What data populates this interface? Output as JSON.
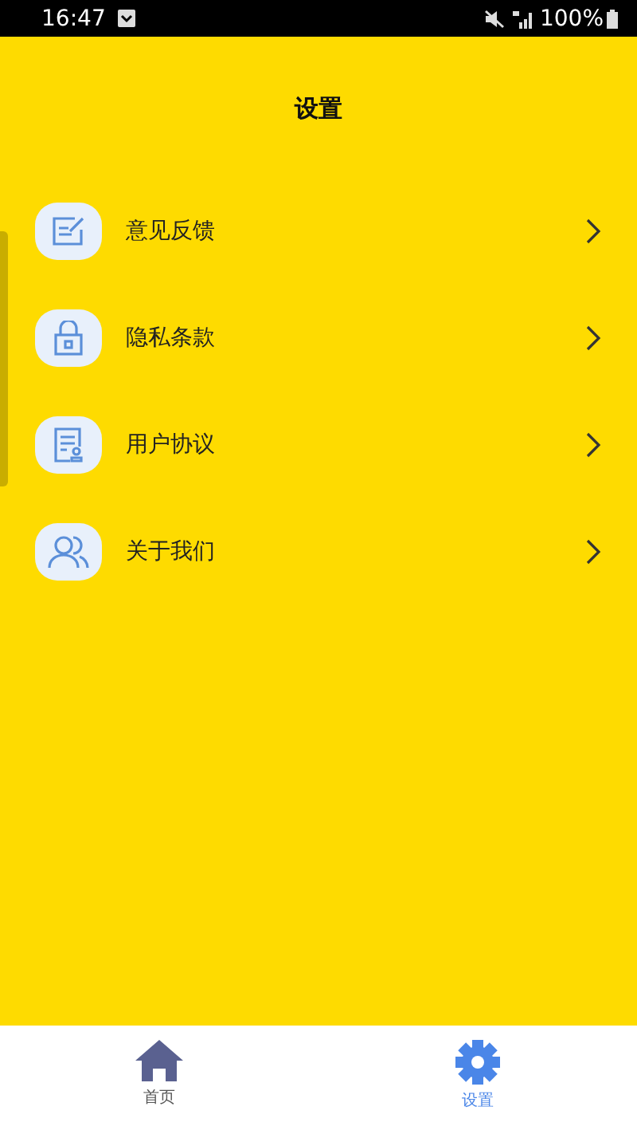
{
  "status_bar": {
    "time": "16:47",
    "battery": "100%"
  },
  "title": "设置",
  "items": [
    {
      "label": "意见反馈",
      "kind": "feedback"
    },
    {
      "label": "隐私条款",
      "kind": "lock"
    },
    {
      "label": "用户协议",
      "kind": "document"
    },
    {
      "label": "关于我们",
      "kind": "users"
    }
  ],
  "tabs": [
    {
      "label": "首页",
      "kind": "home",
      "selected": false
    },
    {
      "label": "设置",
      "kind": "gear",
      "selected": true
    }
  ]
}
